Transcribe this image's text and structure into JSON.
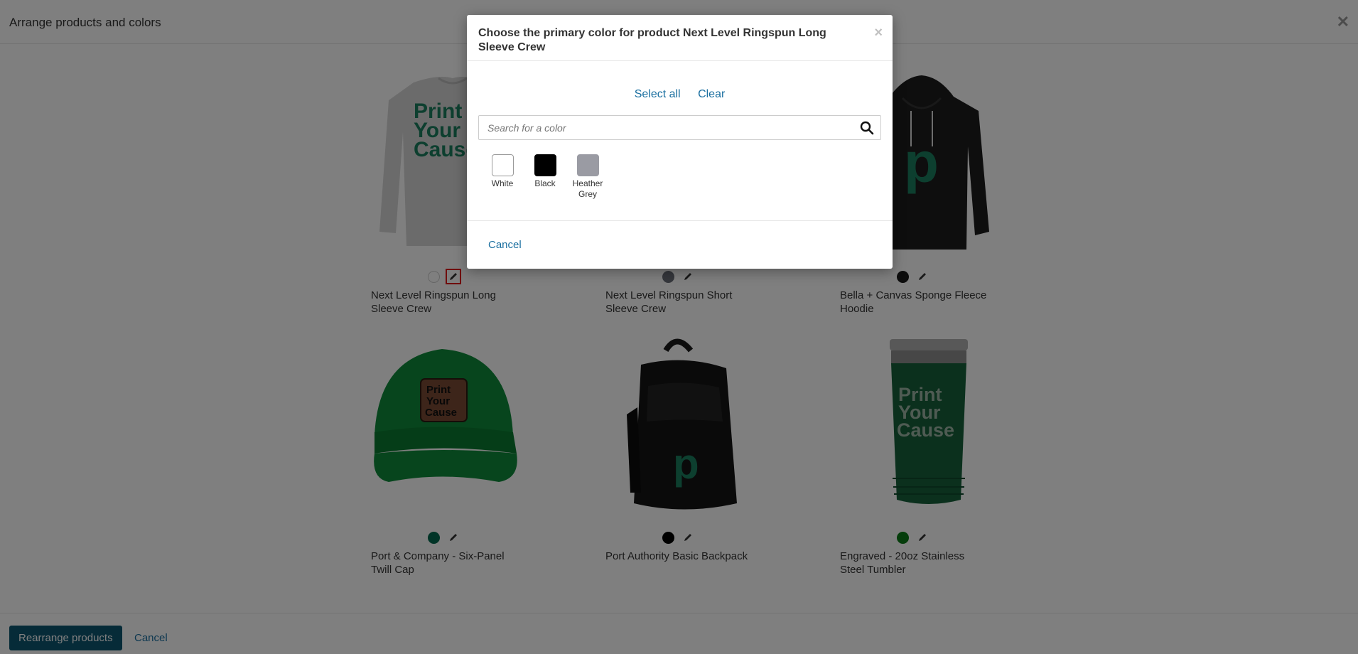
{
  "page": {
    "title": "Arrange products and colors",
    "products": [
      {
        "name": "Next Level Ringspun Long Sleeve Crew",
        "swatch_color": "#ffffff",
        "thumb": "longsleeve"
      },
      {
        "name": "Next Level Ringspun Short Sleeve Crew",
        "swatch_color": "#6b6e78",
        "thumb": "shortsleeve"
      },
      {
        "name": "Bella + Canvas Sponge Fleece Hoodie",
        "swatch_color": "#1a1a1a",
        "thumb": "hoodie"
      },
      {
        "name": "Port & Company - Six-Panel Twill Cap",
        "swatch_color": "#00694e",
        "thumb": "cap"
      },
      {
        "name": "Port Authority Basic Backpack",
        "swatch_color": "#000000",
        "thumb": "backpack"
      },
      {
        "name": "Engraved - 20oz Stainless Steel Tumbler",
        "swatch_color": "#0a7a16",
        "thumb": "tumbler"
      }
    ],
    "thumb_text": {
      "line1": "Print",
      "line2": "Your",
      "line3": "Cause",
      "letter": "p"
    },
    "footer": {
      "rearrange_label": "Rearrange products",
      "cancel_label": "Cancel"
    }
  },
  "modal": {
    "title": "Choose the primary color for product Next Level Ringspun Long Sleeve Crew",
    "close_glyph": "×",
    "select_all_label": "Select all",
    "clear_label": "Clear",
    "search_placeholder": "Search for a color",
    "colors": [
      {
        "label": "White",
        "hex": "#ffffff"
      },
      {
        "label": "Black",
        "hex": "#000000"
      },
      {
        "label": "Heather Grey",
        "hex": "#9a9ba3"
      }
    ],
    "cancel_label": "Cancel"
  },
  "colors": {
    "brand_green": "#1b7f5f",
    "link": "#1a6fa0",
    "primary_button": "#0d5670"
  }
}
